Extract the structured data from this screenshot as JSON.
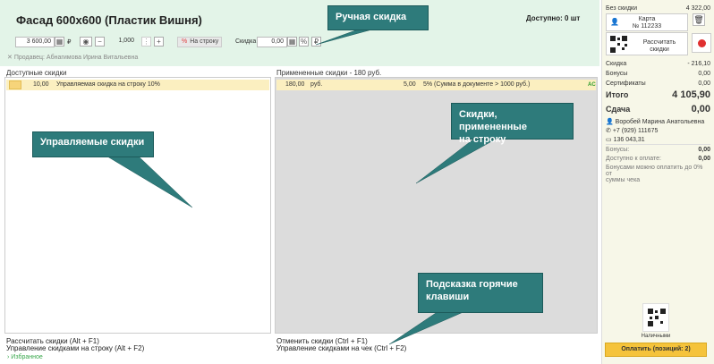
{
  "header": {
    "title": "Фасад 600x600 (Пластик Вишня)",
    "available": "Доступно: 0 шт",
    "price": "3 600,00",
    "currency": "₽",
    "quantity": "1,000",
    "per_line_label": "На строку",
    "discount_label": "Скидка",
    "discount_value": "0,00",
    "seller": "Продавец: Абнагимова Ирина Витальевна"
  },
  "left_panel": {
    "title": "Доступные скидки",
    "rows": [
      {
        "value": "10,00",
        "name": "Управляемая скидка на строку 10%"
      }
    ]
  },
  "right_panel": {
    "title": "Примененные скидки - 180 руб.",
    "rows": [
      {
        "amount": "180,00",
        "unit": "руб.",
        "percent": "5,00",
        "desc": "5% (Сумма в документе > 1000 руб.)",
        "tag": "AC"
      }
    ]
  },
  "hints": {
    "left_1": "Рассчитать скидки (Alt + F1)",
    "left_2": "Управление скидками на строку (Alt + F2)",
    "right_1": "Отменить скидки (Ctrl + F1)",
    "right_2": "Управление скидками на чек (Ctrl + F2)",
    "favorites": "Избранное"
  },
  "sidebar": {
    "no_discount_label": "Без скидки",
    "no_discount_value": "4 322,00",
    "card_label": "Карта",
    "card_number": "№ 112233",
    "calc_line1": "Рассчитать",
    "calc_line2": "скидки",
    "discount_label": "Скидка",
    "discount_value": "- 216,10",
    "bonus_label": "Бонусы",
    "bonus_value": "0,00",
    "cert_label": "Сертификаты",
    "cert_value": "0,00",
    "total_label": "Итого",
    "total_value": "4 105,90",
    "change_label": "Сдача",
    "change_value": "0,00",
    "customer_name": "Воробей Марина Анатольевна",
    "customer_phone": "+7 (929) 111675",
    "customer_card": "136 043,31",
    "bonuses_label": "Бонусы:",
    "bonuses_value": "0,00",
    "payable_label": "Доступно к оплате:",
    "payable_value": "0,00",
    "bonus_note_1": "Бонусами можно оплатить до 0% от",
    "bonus_note_2": "суммы чека",
    "cash_label": "Наличными",
    "pay_button": "Оплатить (позиций: 2)"
  },
  "callouts": {
    "manual": "Ручная скидка",
    "managed": "Управляемые скидки",
    "applied_1": "Скидки, примененные",
    "applied_2": "на строку",
    "hotkeys_1": "Подсказка горячие",
    "hotkeys_2": "клавиши"
  },
  "colors": {
    "header_bg": "#e3f4e8",
    "row_highlight": "#fbefc0",
    "callout": "#2e7b7b",
    "pay_button": "#f5c33b",
    "accent_green": "#3aa84d"
  }
}
